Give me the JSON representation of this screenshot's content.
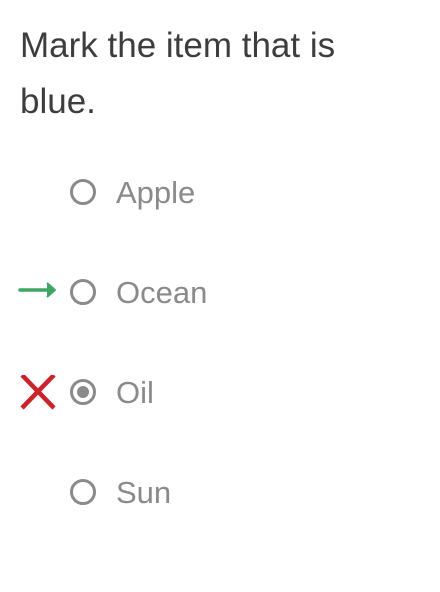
{
  "question": {
    "text": "Mark the item that is blue."
  },
  "options": [
    {
      "label": "Apple",
      "selected": false,
      "feedback": "none"
    },
    {
      "label": "Ocean",
      "selected": false,
      "feedback": "correct-answer-arrow"
    },
    {
      "label": "Oil",
      "selected": true,
      "feedback": "incorrect-x"
    },
    {
      "label": "Sun",
      "selected": false,
      "feedback": "none"
    }
  ],
  "colors": {
    "text": "#3d3d3d",
    "option_text": "#8a8a8a",
    "radio": "#8a8a8a",
    "correct_arrow": "#3fa564",
    "incorrect_x": "#cc2229"
  },
  "icons": {
    "correct": "arrow-right-icon",
    "incorrect": "x-mark-icon"
  }
}
